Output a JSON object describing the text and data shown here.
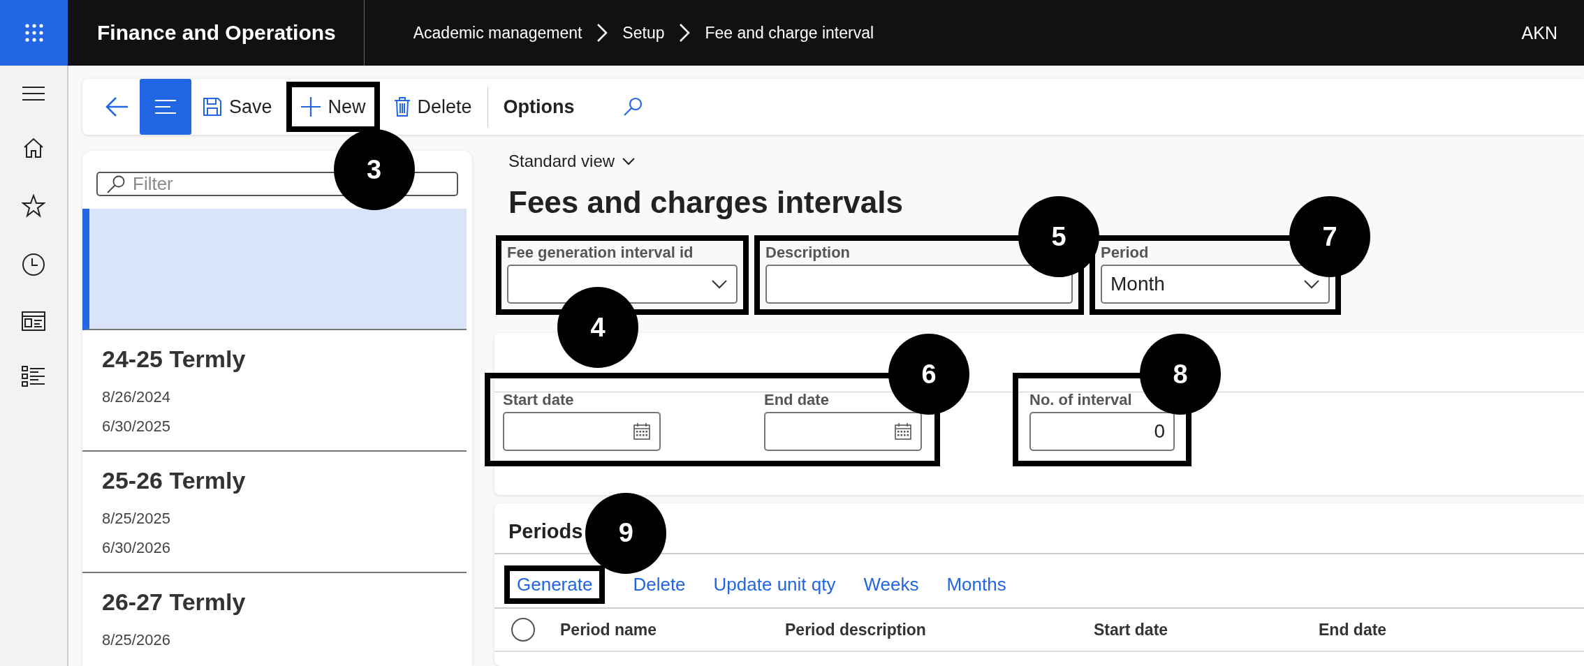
{
  "header": {
    "app_name": "Finance and Operations",
    "breadcrumb": [
      "Academic management",
      "Setup",
      "Fee and charge interval"
    ],
    "user": "AKN"
  },
  "toolbar": {
    "buttons": [
      {
        "kind": "back"
      },
      {
        "kind": "menu",
        "selected": true
      },
      {
        "kind": "save",
        "label": "Save"
      },
      {
        "kind": "new",
        "label": "New",
        "callout": "3"
      },
      {
        "kind": "delete",
        "label": "Delete"
      },
      {
        "kind": "options",
        "label": "Options"
      },
      {
        "kind": "search"
      }
    ]
  },
  "list": {
    "filter_placeholder": "Filter",
    "items": [
      {
        "selected": true
      },
      {
        "title": "24-25 Termly",
        "start": "8/26/2024",
        "end": "6/30/2025",
        "selected": false
      },
      {
        "title": "25-26 Termly",
        "start": "8/25/2025",
        "end": "6/30/2026",
        "selected": false
      },
      {
        "title": "26-27 Termly",
        "start": "8/25/2026",
        "selected": false
      }
    ]
  },
  "view": "Standard view",
  "page_title": "Fees and charges intervals",
  "header_fields": [
    {
      "kind": "dropdown",
      "label": "Fee generation interval id",
      "callout": "4"
    },
    {
      "kind": "text",
      "label": "Description",
      "callout": "5"
    },
    {
      "kind": "dropdown",
      "label": "Period",
      "value": "Month",
      "callout": "7"
    }
  ],
  "dates": {
    "callout": "6",
    "fields": [
      {
        "label": "Start date"
      },
      {
        "label": "End date"
      }
    ]
  },
  "interval": {
    "label": "No. of interval",
    "value": "0",
    "callout": "8"
  },
  "periods": {
    "title": "Periods",
    "actions": [
      {
        "label": "Generate",
        "callout": "9"
      },
      {
        "label": "Delete"
      },
      {
        "label": "Update unit qty"
      },
      {
        "label": "Weeks"
      },
      {
        "label": "Months"
      }
    ],
    "select_all_checked": false,
    "columns": [
      "Period name",
      "Period description",
      "Start date",
      "End date"
    ]
  }
}
